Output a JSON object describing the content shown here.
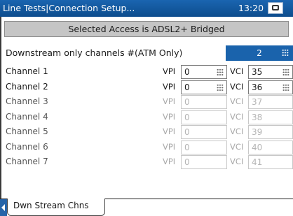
{
  "window": {
    "title": "Line Tests|Connection Setup...",
    "time": "13:20",
    "status_icon": "power-status-icon"
  },
  "banner": {
    "text": "Selected Access  is ADSL2+ Bridged"
  },
  "downstream": {
    "label": "Downstream only channels #(ATM Only)",
    "count": "2"
  },
  "channels": [
    {
      "label": "Channel 1",
      "vpi_label": "VPI",
      "vpi": "0",
      "vci_label": "VCI",
      "vci": "35",
      "enabled": true
    },
    {
      "label": "Channel 2",
      "vpi_label": "VPI",
      "vpi": "0",
      "vci_label": "VCI",
      "vci": "36",
      "enabled": true
    },
    {
      "label": "Channel 3",
      "vpi_label": "VPI",
      "vpi": "0",
      "vci_label": "VCI",
      "vci": "37",
      "enabled": false
    },
    {
      "label": "Channel 4",
      "vpi_label": "VPI",
      "vpi": "0",
      "vci_label": "VCI",
      "vci": "38",
      "enabled": false
    },
    {
      "label": "Channel 5",
      "vpi_label": "VPI",
      "vpi": "0",
      "vci_label": "VCI",
      "vci": "39",
      "enabled": false
    },
    {
      "label": "Channel 6",
      "vpi_label": "VPI",
      "vpi": "0",
      "vci_label": "VCI",
      "vci": "40",
      "enabled": false
    },
    {
      "label": "Channel 7",
      "vpi_label": "VPI",
      "vpi": "0",
      "vci_label": "VCI",
      "vci": "41",
      "enabled": false
    }
  ],
  "tabs": [
    {
      "label": "Dwn Stream Chns"
    }
  ],
  "colors": {
    "titlebar": "#0d4c8d",
    "accent": "#1a63ac",
    "banner": "#c5c5c5"
  }
}
